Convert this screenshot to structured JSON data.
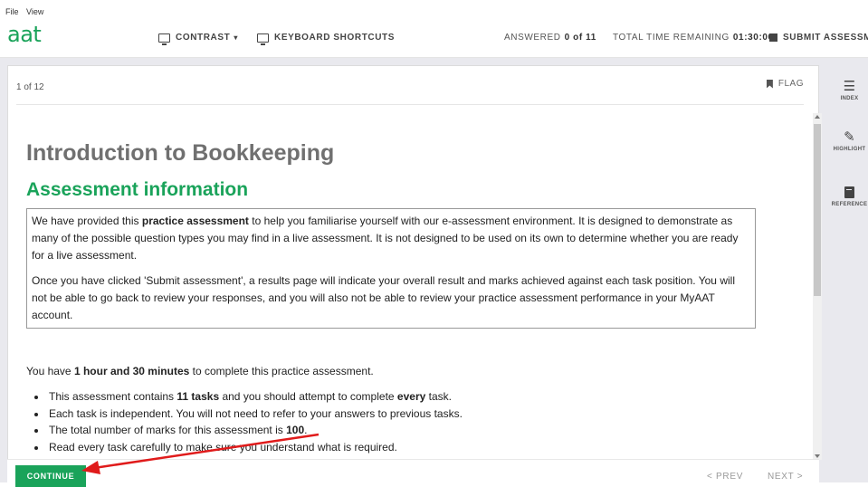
{
  "menubar": {
    "items": [
      "File",
      "View"
    ]
  },
  "header": {
    "logo": "aat",
    "contrast_label": "CONTRAST",
    "shortcuts_label": "KEYBOARD SHORTCUTS",
    "answered_label": "ANSWERED",
    "answered_value": "0 of 11",
    "time_label": "TOTAL TIME REMAINING",
    "time_value": "01:30:00",
    "submit_label": "SUBMIT ASSESSMENT"
  },
  "panel": {
    "question_count": "1 of 12",
    "flag_label": "FLAG",
    "title": "Introduction to Bookkeeping",
    "subtitle": "Assessment information",
    "info": {
      "p1_a": "We have provided this ",
      "p1_b": "practice assessment",
      "p1_c": " to help you familiarise yourself with our e-assessment environment. It is designed to demonstrate as many of the possible question types you may find in a live assessment. It is not designed to be used on its own to determine whether you are ready for a live assessment.",
      "p2": "Once you have clicked 'Submit assessment', a results page will indicate your overall result and marks achieved against each task position. You will not be able to go back to review your responses, and you will also not be able to review your practice assessment performance in your MyAAT account."
    },
    "time_para": {
      "a": "You have ",
      "b": "1 hour and 30 minutes",
      "c": " to complete this practice assessment."
    },
    "bullets": {
      "b1_a": "This assessment contains ",
      "b1_b": "11 tasks",
      "b1_c": " and you should attempt to complete ",
      "b1_d": "every",
      "b1_e": " task.",
      "b2": "Each task is independent. You will not need to refer to your answers to previous tasks.",
      "b3_a": "The total number of marks for this assessment is ",
      "b3_b": "100",
      "b3_c": ".",
      "b4": "Read every task carefully to make sure you understand what is required."
    }
  },
  "footer": {
    "continue_label": "CONTINUE",
    "prev_label": "PREV",
    "next_label": "NEXT"
  },
  "sidebar": {
    "index_label": "INDEX",
    "highlight_label": "HIGHLIGHT",
    "reference_label": "REFERENCE"
  },
  "colors": {
    "brand_green": "#1aa35a",
    "annotation_arrow": "#e01b1b"
  }
}
